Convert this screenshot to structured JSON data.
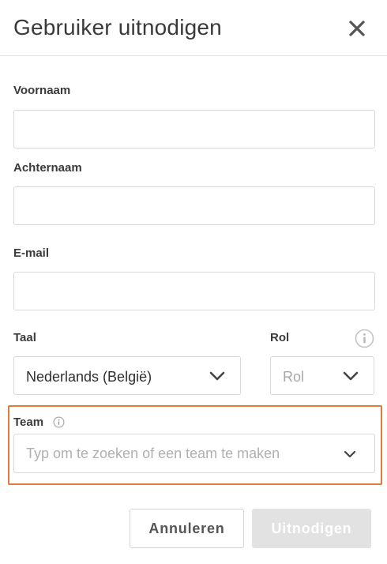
{
  "dialog": {
    "title": "Gebruiker uitnodigen",
    "close_icon": "close-icon"
  },
  "form": {
    "first_name": {
      "label": "Voornaam",
      "value": ""
    },
    "last_name": {
      "label": "Achternaam",
      "value": ""
    },
    "email": {
      "label": "E-mail",
      "value": ""
    },
    "language": {
      "label": "Taal",
      "value": "Nederlands (België)"
    },
    "role": {
      "label": "Rol",
      "placeholder": "Rol",
      "info_icon": "info-icon"
    },
    "team": {
      "label": "Team",
      "placeholder": "Typ om te zoeken of een team te maken",
      "info_icon": "info-icon"
    }
  },
  "footer": {
    "cancel_label": "Annuleren",
    "invite_label": "Uitnodigen"
  },
  "colors": {
    "highlight": "#e07b3c",
    "disabled_button": "#e2e2e2"
  }
}
